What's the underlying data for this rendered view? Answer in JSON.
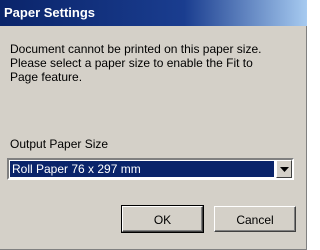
{
  "window": {
    "title": "Paper Settings"
  },
  "message": {
    "lines": [
      "Document cannot be printed on this paper size.",
      "Please select a paper size to enable the Fit to",
      "Page feature."
    ]
  },
  "output_paper_size": {
    "label": "Output Paper Size",
    "selected_value": "Roll Paper 76 x 297 mm"
  },
  "buttons": {
    "ok_label": "OK",
    "cancel_label": "Cancel"
  },
  "colors": {
    "title_bar": "#0a246a",
    "dialog_face": "#d4d0c8",
    "selection_highlight": "#0a246a"
  },
  "icons": {
    "dropdown": "chevron-down-icon"
  }
}
